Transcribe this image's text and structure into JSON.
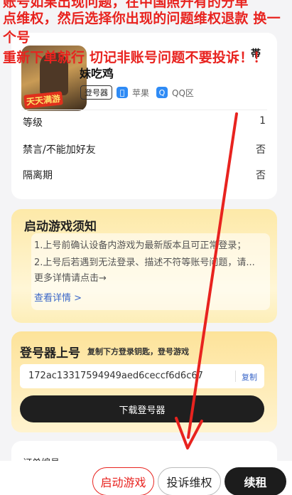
{
  "overlay": {
    "line1": "账号如果出现问题，在中国照开有的分单",
    "line2": "点维权，然后选择你出现的问题维权退款 换一",
    "line3": "个号",
    "line4": "重新下单就行 切记非账号问题不要投诉！！"
  },
  "product": {
    "game_name": "妹吃鸡",
    "rank_tag": "帯",
    "thumb_logo": "天天满游",
    "tags": {
      "login_tool": "登号器",
      "platform_icon": "apple-icon",
      "platform": "苹果",
      "region_icon": "qq-icon",
      "region": "QQ区"
    },
    "rows": [
      {
        "label": "等级",
        "value": "1"
      },
      {
        "label": "禁言/不能加好友",
        "value": "否"
      },
      {
        "label": "隔离期",
        "value": "否"
      }
    ]
  },
  "notice": {
    "title": "启动游戏须知",
    "line1": "1.上号前确认设备内游戏为最新版本且可正常登录；",
    "line2": "2.上号后若遇到无法登录、描述不符等账号问题，请...",
    "line3": "更多详情请点击→",
    "link": "查看详情 >"
  },
  "login": {
    "title": "登号器上号",
    "subtitle": "复制下方登录钥匙，登号游戏",
    "key": "172ac13317594949aed6ceccf6d6c67",
    "copy": "复制",
    "download": "下载登号器"
  },
  "order": {
    "label": "订单编号"
  },
  "actions": {
    "start": "启动游戏",
    "complain": "投诉维权",
    "renew": "续租"
  },
  "colors": {
    "accent_red": "#e8231f",
    "dark": "#1f1f1f",
    "notice_bg": "#fde9a8",
    "link_blue": "#3a66c8"
  }
}
